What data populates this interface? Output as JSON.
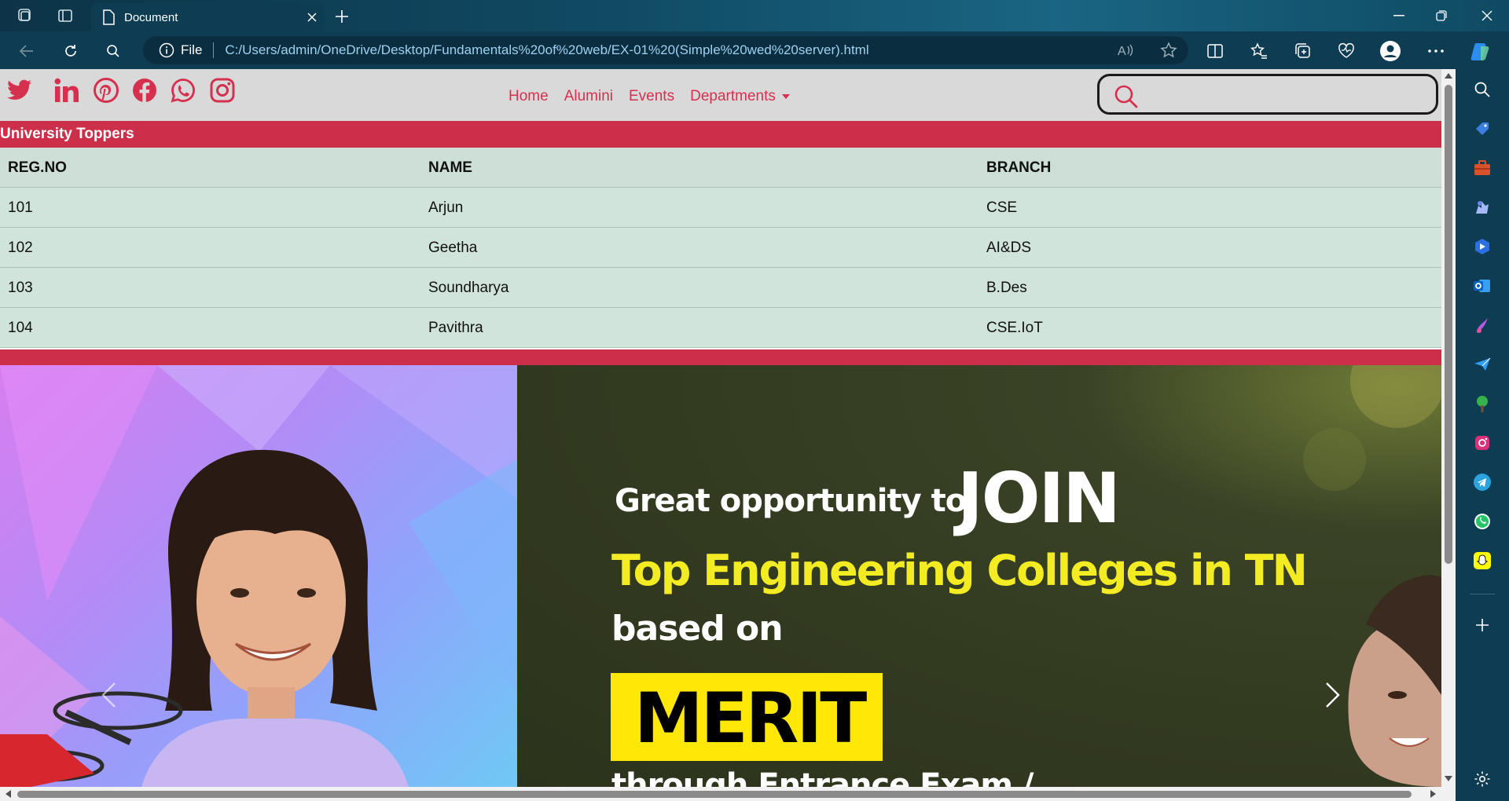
{
  "browser": {
    "tab_title": "Document",
    "address_scheme": "File",
    "url": "C:/Users/admin/OneDrive/Desktop/Fundamentals%20of%20web/EX-01%20(Simple%20wed%20server).html",
    "colors": {
      "frame": "#0e3c52",
      "url_text": "#9fd0f0"
    }
  },
  "site": {
    "social_icons": [
      "twitter-icon",
      "linkedin-icon",
      "pinterest-icon",
      "facebook-icon",
      "whatsapp-icon",
      "instagram-icon"
    ],
    "menu": [
      {
        "label": "Home"
      },
      {
        "label": "Alumini"
      },
      {
        "label": "Events"
      },
      {
        "label": "Departments"
      }
    ],
    "search": {
      "placeholder": ""
    },
    "accent_color": "#cc2f4a",
    "link_color": "#d6304f"
  },
  "toppers": {
    "title": "University Toppers",
    "headers": [
      "REG.NO",
      "NAME",
      "BRANCH"
    ],
    "rows": [
      [
        "101",
        "Arjun",
        "CSE"
      ],
      [
        "102",
        "Geetha",
        "AI&DS"
      ],
      [
        "103",
        "Soundharya",
        "B.Des"
      ],
      [
        "104",
        "Pavithra",
        "CSE.IoT"
      ]
    ]
  },
  "carousel": {
    "line1": "Great opportunity to",
    "line1_big": "JOIN",
    "line2": "Top Engineering Colleges in TN",
    "line3": "based on",
    "highlight": "MERIT",
    "line4_partial": "through Entrance Exam /"
  }
}
